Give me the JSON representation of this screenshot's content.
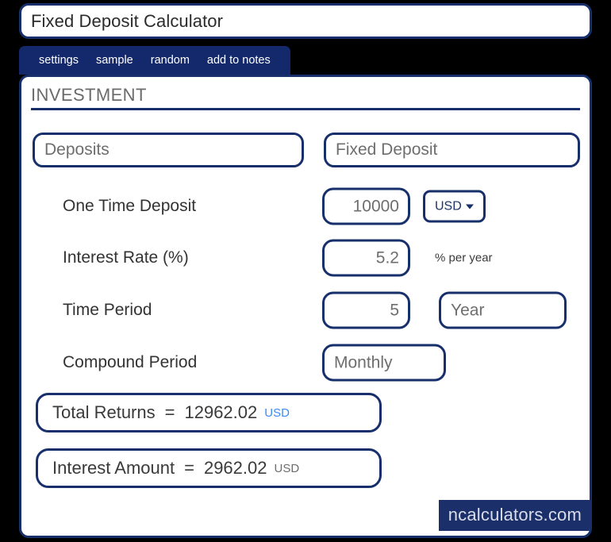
{
  "window": {
    "title": "Fixed Deposit Calculator"
  },
  "tabs": [
    {
      "label": "settings",
      "name": "tab-settings"
    },
    {
      "label": "sample",
      "name": "tab-sample"
    },
    {
      "label": "random",
      "name": "tab-random"
    },
    {
      "label": "add to notes",
      "name": "tab-add-to-notes"
    }
  ],
  "section": {
    "heading": "INVESTMENT"
  },
  "selectors": {
    "category": "Deposits",
    "product": "Fixed Deposit"
  },
  "fields": [
    {
      "label": "One Time Deposit",
      "value": "10000",
      "unit": "USD",
      "unit_kind": "dropdown"
    },
    {
      "label": "Interest Rate (%)",
      "value": "5.2",
      "note": "% per year",
      "unit_kind": "note"
    },
    {
      "label": "Time Period",
      "value": "5",
      "unit": "Year",
      "unit_kind": "plain"
    },
    {
      "label": "Compound Period",
      "value": "Monthly",
      "unit_kind": "none"
    }
  ],
  "results": [
    {
      "label": "Total Returns",
      "equals": "=",
      "value": "12962.02",
      "currency": "USD",
      "currency_color": "#3d8bf2"
    },
    {
      "label": "Interest Amount",
      "equals": "=",
      "value": "2962.02",
      "currency": "USD",
      "currency_color": "#6e6e6e"
    }
  ],
  "footer": {
    "brand": "ncalculators.com"
  },
  "colors": {
    "navy_border": "#17306b",
    "tab_bar": "#14296b",
    "badge_bg": "#1b2f6b",
    "accent_blue": "#3d8bf2",
    "label_grey": "#333333",
    "value_grey": "#6e6e6e",
    "page_bg": "#000000"
  }
}
